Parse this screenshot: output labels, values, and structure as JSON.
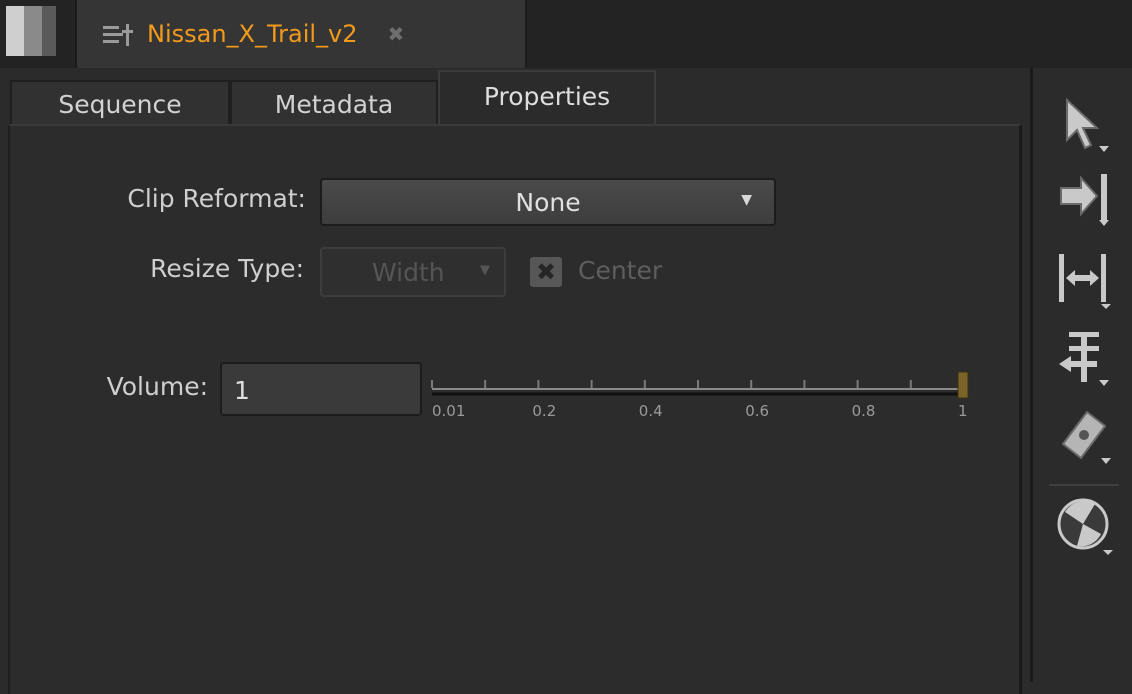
{
  "document_tab": {
    "title": "Nissan_X_Trail_v2",
    "close_glyph": "✖",
    "icon": "sequence-icon",
    "title_color": "#f29a1b"
  },
  "tabs": [
    {
      "label": "Sequence",
      "active": false
    },
    {
      "label": "Metadata",
      "active": false
    },
    {
      "label": "Properties",
      "active": true
    }
  ],
  "properties": {
    "clip_reformat": {
      "label": "Clip Reformat:",
      "value": "None"
    },
    "resize_type": {
      "label": "Resize Type:",
      "value": "Width",
      "enabled": false
    },
    "center": {
      "label": "Center",
      "checked": true,
      "enabled": false
    },
    "volume": {
      "label": "Volume:",
      "value": "1",
      "slider_value": 1,
      "ticks": [
        "0.01",
        "0.2",
        "0.4",
        "0.6",
        "0.8",
        "1"
      ]
    }
  },
  "toolbar": {
    "tools": [
      "select-arrow-icon",
      "track-select-icon",
      "slip-icon",
      "slide-icon",
      "razor-icon",
      "transform-icon"
    ]
  }
}
